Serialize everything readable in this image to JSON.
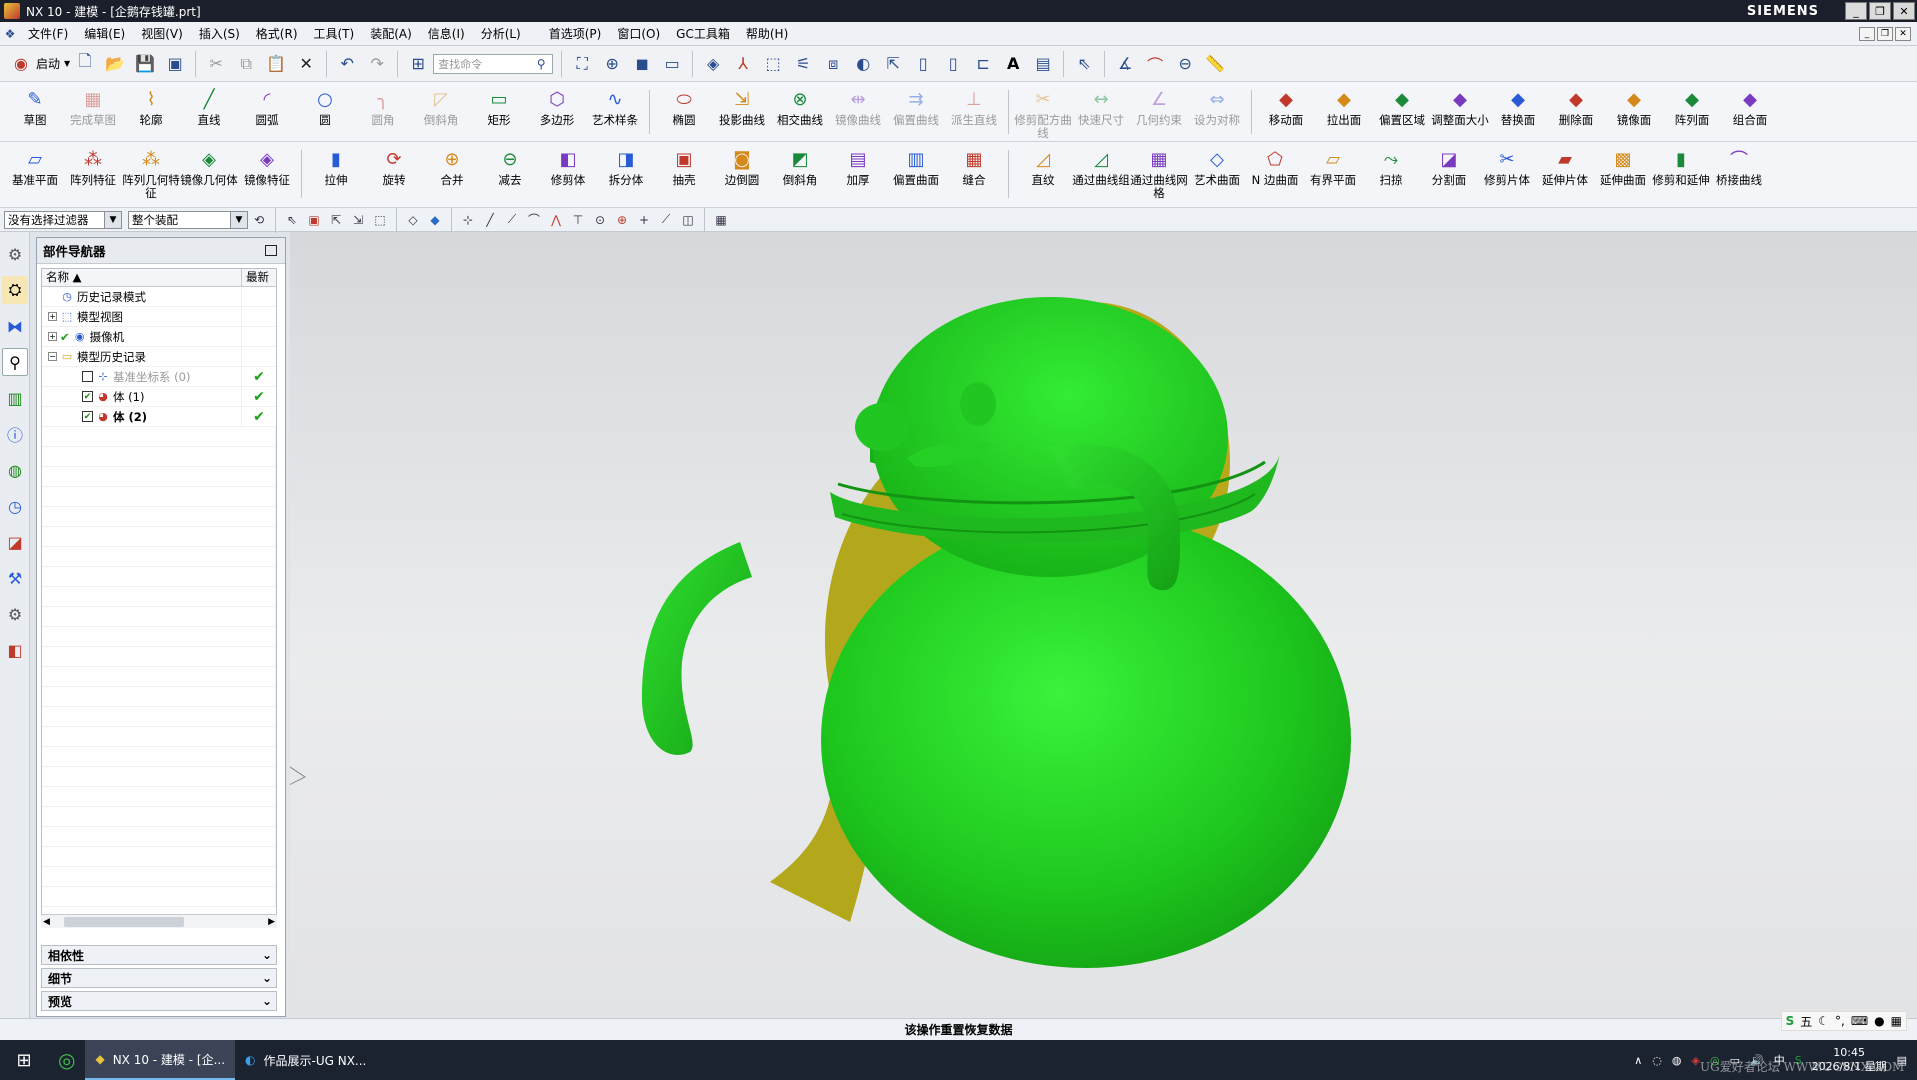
{
  "window": {
    "title": "NX 10 - 建模 - [企鹅存钱罐.prt]",
    "brand": "SIEMENS",
    "min": "_",
    "restore": "❐",
    "close": "✕"
  },
  "menu": [
    "文件(F)",
    "编辑(E)",
    "视图(V)",
    "插入(S)",
    "格式(R)",
    "工具(T)",
    "装配(A)",
    "信息(I)",
    "分析(L)",
    "首选项(P)",
    "窗口(O)",
    "GC工具箱",
    "帮助(H)"
  ],
  "stdbar": {
    "start_label": "启动",
    "search_placeholder": "查找命令"
  },
  "ribbon1": [
    {
      "label": "草图",
      "icon": "sketch-icon",
      "glyph": "✎",
      "disabled": false
    },
    {
      "label": "完成草图",
      "icon": "finish-sketch-icon",
      "glyph": "▦",
      "disabled": true
    },
    {
      "label": "轮廓",
      "icon": "profile-icon",
      "glyph": "⌇",
      "disabled": false
    },
    {
      "label": "直线",
      "icon": "line-icon",
      "glyph": "╱",
      "disabled": false
    },
    {
      "label": "圆弧",
      "icon": "arc-icon",
      "glyph": "◜",
      "disabled": false
    },
    {
      "label": "圆",
      "icon": "circle-icon",
      "glyph": "○",
      "disabled": false
    },
    {
      "label": "圆角",
      "icon": "fillet-icon",
      "glyph": "╮",
      "disabled": true
    },
    {
      "label": "倒斜角",
      "icon": "chamfer-icon",
      "glyph": "◸",
      "disabled": true
    },
    {
      "label": "矩形",
      "icon": "rectangle-icon",
      "glyph": "▭",
      "disabled": false
    },
    {
      "label": "多边形",
      "icon": "polygon-icon",
      "glyph": "⬡",
      "disabled": false
    },
    {
      "label": "艺术样条",
      "icon": "spline-icon",
      "glyph": "∿",
      "disabled": false
    },
    {
      "label": "椭圆",
      "icon": "ellipse-icon",
      "glyph": "⬭",
      "disabled": false
    },
    {
      "label": "投影曲线",
      "icon": "project-curve-icon",
      "glyph": "⇲",
      "disabled": false
    },
    {
      "label": "相交曲线",
      "icon": "intersect-curve-icon",
      "glyph": "⊗",
      "disabled": false
    },
    {
      "label": "镜像曲线",
      "icon": "mirror-curve-icon",
      "glyph": "⇹",
      "disabled": true
    },
    {
      "label": "偏置曲线",
      "icon": "offset-curve-icon",
      "glyph": "⇉",
      "disabled": true
    },
    {
      "label": "派生直线",
      "icon": "derived-line-icon",
      "glyph": "⊥",
      "disabled": true
    },
    {
      "label": "修剪配方曲线",
      "icon": "trim-recipe-icon",
      "glyph": "✂",
      "disabled": true
    },
    {
      "label": "快速尺寸",
      "icon": "rapid-dimension-icon",
      "glyph": "↔",
      "disabled": true
    },
    {
      "label": "几何约束",
      "icon": "geometric-constraint-icon",
      "glyph": "∠",
      "disabled": true
    },
    {
      "label": "设为对称",
      "icon": "make-symmetric-icon",
      "glyph": "⇔",
      "disabled": true
    },
    {
      "label": "移动面",
      "icon": "move-face-icon",
      "glyph": "◆",
      "disabled": false
    },
    {
      "label": "拉出面",
      "icon": "pull-face-icon",
      "glyph": "◆",
      "disabled": false
    },
    {
      "label": "偏置区域",
      "icon": "offset-region-icon",
      "glyph": "◆",
      "disabled": false
    },
    {
      "label": "调整面大小",
      "icon": "resize-face-icon",
      "glyph": "◆",
      "disabled": false
    },
    {
      "label": "替换面",
      "icon": "replace-face-icon",
      "glyph": "◆",
      "disabled": false
    },
    {
      "label": "删除面",
      "icon": "delete-face-icon",
      "glyph": "◆",
      "disabled": false
    },
    {
      "label": "镜像面",
      "icon": "mirror-face-icon",
      "glyph": "◆",
      "disabled": false
    },
    {
      "label": "阵列面",
      "icon": "pattern-face-icon",
      "glyph": "◆",
      "disabled": false
    },
    {
      "label": "组合面",
      "icon": "group-face-icon",
      "glyph": "◆",
      "disabled": false
    }
  ],
  "ribbon2": [
    {
      "label": "基准平面",
      "icon": "datum-plane-icon",
      "glyph": "▱"
    },
    {
      "label": "阵列特征",
      "icon": "pattern-feature-icon",
      "glyph": "⁂"
    },
    {
      "label": "阵列几何特征",
      "icon": "pattern-geometry-icon",
      "glyph": "⁂"
    },
    {
      "label": "镜像几何体",
      "icon": "mirror-geometry-icon",
      "glyph": "◈"
    },
    {
      "label": "镜像特征",
      "icon": "mirror-feature-icon",
      "glyph": "◈"
    },
    {
      "label": "拉伸",
      "icon": "extrude-icon",
      "glyph": "▮"
    },
    {
      "label": "旋转",
      "icon": "revolve-icon",
      "glyph": "⟳"
    },
    {
      "label": "合并",
      "icon": "unite-icon",
      "glyph": "⊕"
    },
    {
      "label": "减去",
      "icon": "subtract-icon",
      "glyph": "⊖"
    },
    {
      "label": "修剪体",
      "icon": "trim-body-icon",
      "glyph": "◧"
    },
    {
      "label": "拆分体",
      "icon": "split-body-icon",
      "glyph": "◨"
    },
    {
      "label": "抽壳",
      "icon": "shell-icon",
      "glyph": "▣"
    },
    {
      "label": "边倒圆",
      "icon": "edge-blend-icon",
      "glyph": "◙"
    },
    {
      "label": "倒斜角",
      "icon": "chamfer-solid-icon",
      "glyph": "◩"
    },
    {
      "label": "加厚",
      "icon": "thicken-icon",
      "glyph": "▤"
    },
    {
      "label": "偏置曲面",
      "icon": "offset-surface-icon",
      "glyph": "▥"
    },
    {
      "label": "缝合",
      "icon": "sew-icon",
      "glyph": "▦"
    },
    {
      "label": "直纹",
      "icon": "ruled-icon",
      "glyph": "◿"
    },
    {
      "label": "通过曲线组",
      "icon": "through-curves-icon",
      "glyph": "◿"
    },
    {
      "label": "通过曲线网格",
      "icon": "through-curve-mesh-icon",
      "glyph": "▦"
    },
    {
      "label": "艺术曲面",
      "icon": "studio-surface-icon",
      "glyph": "◇"
    },
    {
      "label": "N 边曲面",
      "icon": "n-sided-surface-icon",
      "glyph": "⬠"
    },
    {
      "label": "有界平面",
      "icon": "bounded-plane-icon",
      "glyph": "▱"
    },
    {
      "label": "扫掠",
      "icon": "swept-icon",
      "glyph": "⤳"
    },
    {
      "label": "分割面",
      "icon": "divide-face-icon",
      "glyph": "◪"
    },
    {
      "label": "修剪片体",
      "icon": "trim-sheet-icon",
      "glyph": "✂"
    },
    {
      "label": "延伸片体",
      "icon": "extend-sheet-icon",
      "glyph": "▰"
    },
    {
      "label": "延伸曲面",
      "icon": "extend-surface-icon",
      "glyph": "▩"
    },
    {
      "label": "修剪和延伸",
      "icon": "trim-extend-icon",
      "glyph": "▮"
    },
    {
      "label": "桥接曲线",
      "icon": "bridge-curve-icon",
      "glyph": "⌒"
    }
  ],
  "filterbar": {
    "filter": "没有选择过滤器",
    "scope": "整个装配"
  },
  "navigator": {
    "title": "部件导航器",
    "col_name": "名称",
    "col_latest": "最新",
    "rows": [
      {
        "label": "历史记录模式",
        "indent": 0,
        "exp": "",
        "check": false,
        "icon": "clock-icon",
        "glyph": "◷",
        "latest": "",
        "grey": false,
        "hasCb": false
      },
      {
        "label": "模型视图",
        "indent": 0,
        "exp": "+",
        "check": false,
        "icon": "model-views-icon",
        "glyph": "⬚",
        "latest": "",
        "grey": false,
        "hasCb": false
      },
      {
        "label": "摄像机",
        "indent": 0,
        "exp": "+",
        "check": true,
        "icon": "camera-icon",
        "glyph": "◉",
        "latest": "",
        "grey": false,
        "hasCb": false,
        "tick": true
      },
      {
        "label": "模型历史记录",
        "indent": 0,
        "exp": "−",
        "check": false,
        "icon": "folder-icon",
        "glyph": "▭",
        "latest": "",
        "grey": false,
        "hasCb": false
      },
      {
        "label": "基准坐标系 (0)",
        "indent": 1,
        "exp": "",
        "check": false,
        "icon": "datum-csys-icon",
        "glyph": "⊹",
        "latest": "✔",
        "grey": true,
        "hasCb": true
      },
      {
        "label": "体 (1)",
        "indent": 1,
        "exp": "",
        "check": true,
        "icon": "body-icon",
        "glyph": "◕",
        "latest": "✔",
        "grey": false,
        "hasCb": true
      },
      {
        "label": "体 (2)",
        "indent": 1,
        "exp": "",
        "check": true,
        "icon": "body-icon",
        "glyph": "◕",
        "latest": "✔",
        "grey": false,
        "hasCb": true,
        "bold": true
      }
    ],
    "sections": [
      "相依性",
      "细节",
      "预览"
    ]
  },
  "status": {
    "message": "该操作重置恢复数据"
  },
  "ime": {
    "mode": "五"
  },
  "taskbar": {
    "apps": [
      {
        "label": "NX 10 - 建模 - [企...",
        "active": true
      },
      {
        "label": "作品展示-UG NX...",
        "active": false
      }
    ],
    "time": "10:45",
    "date": "2026/8/1 星期",
    "ime_lang": "中"
  },
  "watermark": "UG爱好者论坛 WWW.UGSNX.COM",
  "colors": {
    "model_green": "#22d122",
    "model_yellow": "#b8a81a",
    "titlebar": "#1a1f2b"
  }
}
